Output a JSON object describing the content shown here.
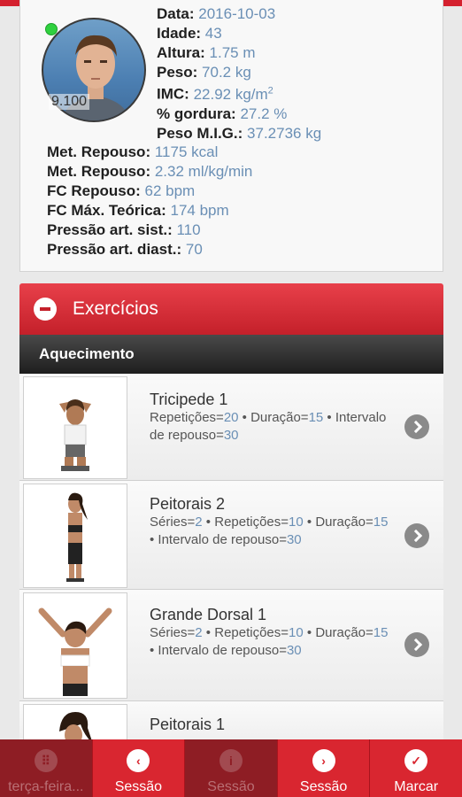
{
  "profile": {
    "avatar_score": "9.100",
    "fields": [
      {
        "label": "Data:",
        "value": "2016-10-03"
      },
      {
        "label": "Idade:",
        "value": "43"
      },
      {
        "label": "Altura:",
        "value": "1.75 m"
      },
      {
        "label": "Peso:",
        "value": "70.2 kg"
      },
      {
        "label": "IMC:",
        "value": "22.92 kg/m",
        "sup": "2"
      },
      {
        "label": "% gordura:",
        "value": "27.2 %"
      },
      {
        "label": "Peso M.I.G.:",
        "value": "37.2736 kg"
      },
      {
        "label": "Met. Repouso:",
        "value": "1175 kcal"
      },
      {
        "label": "Met. Repouso:",
        "value": "2.32 ml/kg/min"
      },
      {
        "label": "FC Repouso:",
        "value": "62 bpm"
      },
      {
        "label": "FC Máx. Teórica:",
        "value": "174 bpm"
      },
      {
        "label": "Pressão art. sist.:",
        "value": "110"
      },
      {
        "label": "Pressão art. diast.:",
        "value": "70"
      }
    ]
  },
  "exercises_section": {
    "title": "Exercícios",
    "group_title": "Aquecimento",
    "items": [
      {
        "name": "Tricipede 1",
        "params": [
          {
            "k": "Repetições",
            "v": "20"
          },
          {
            "k": "Duração",
            "v": "15"
          },
          {
            "k": "Intervalo de repouso",
            "v": "30"
          }
        ]
      },
      {
        "name": "Peitorais 2",
        "params": [
          {
            "k": "Séries",
            "v": "2"
          },
          {
            "k": "Repetições",
            "v": "10"
          },
          {
            "k": "Duração",
            "v": "15"
          },
          {
            "k": "Intervalo de repouso",
            "v": "30"
          }
        ]
      },
      {
        "name": "Grande Dorsal 1",
        "params": [
          {
            "k": "Séries",
            "v": "2"
          },
          {
            "k": "Repetições",
            "v": "10"
          },
          {
            "k": "Duração",
            "v": "15"
          },
          {
            "k": "Intervalo de repouso",
            "v": "30"
          }
        ]
      },
      {
        "name": "Peitorais 1",
        "params": []
      }
    ]
  },
  "bottom_nav": [
    {
      "label": "terça-feira...",
      "icon": "grid-icon",
      "glyph": "⠿",
      "state": "disabled"
    },
    {
      "label": "Sessão",
      "icon": "chevron-left-icon",
      "glyph": "‹",
      "state": "enabled"
    },
    {
      "label": "Sessão",
      "icon": "info-icon",
      "glyph": "i",
      "state": "disabled"
    },
    {
      "label": "Sessão",
      "icon": "chevron-right-icon",
      "glyph": "›",
      "state": "enabled"
    },
    {
      "label": "Marcar",
      "icon": "checkmark-icon",
      "glyph": "✓",
      "state": "enabled"
    }
  ],
  "colors": {
    "brand_red": "#d92630",
    "value_blue": "#6a8fb5",
    "online_green": "#2fd13f"
  }
}
